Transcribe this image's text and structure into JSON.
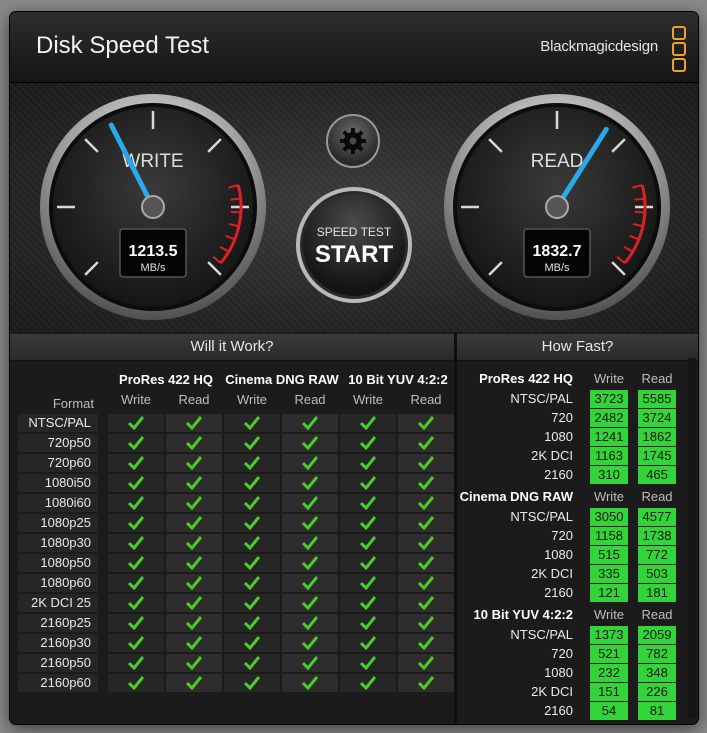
{
  "window": {
    "title": "Disk Speed Test",
    "brand": "Blackmagicdesign"
  },
  "gauges": {
    "write": {
      "label": "WRITE",
      "value": "1213.5",
      "unit": "MB/s",
      "fraction": 0.4
    },
    "read": {
      "label": "READ",
      "value": "1832.7",
      "unit": "MB/s",
      "fraction": 0.62
    }
  },
  "controls": {
    "start_small": "SPEED TEST",
    "start_big": "START",
    "settings_icon": "gear-icon"
  },
  "will_it_work": {
    "title": "Will it Work?",
    "format_header": "Format",
    "groups": [
      {
        "name": "ProRes 422 HQ",
        "cols": [
          "Write",
          "Read"
        ]
      },
      {
        "name": "Cinema DNG RAW",
        "cols": [
          "Write",
          "Read"
        ]
      },
      {
        "name": "10 Bit YUV 4:2:2",
        "cols": [
          "Write",
          "Read"
        ]
      }
    ],
    "formats": [
      "NTSC/PAL",
      "720p50",
      "720p60",
      "1080i50",
      "1080i60",
      "1080p25",
      "1080p30",
      "1080p50",
      "1080p60",
      "2K DCI 25",
      "2160p25",
      "2160p30",
      "2160p50",
      "2160p60"
    ],
    "check_icon": "checkmark-icon"
  },
  "how_fast": {
    "title": "How Fast?",
    "groups": [
      {
        "name": "ProRes 422 HQ",
        "write_label": "Write",
        "read_label": "Read",
        "rows": [
          {
            "label": "NTSC/PAL",
            "write": "3723",
            "read": "5585"
          },
          {
            "label": "720",
            "write": "2482",
            "read": "3724"
          },
          {
            "label": "1080",
            "write": "1241",
            "read": "1862"
          },
          {
            "label": "2K DCI",
            "write": "1163",
            "read": "1745"
          },
          {
            "label": "2160",
            "write": "310",
            "read": "465"
          }
        ]
      },
      {
        "name": "Cinema DNG RAW",
        "write_label": "Write",
        "read_label": "Read",
        "rows": [
          {
            "label": "NTSC/PAL",
            "write": "3050",
            "read": "4577"
          },
          {
            "label": "720",
            "write": "1158",
            "read": "1738"
          },
          {
            "label": "1080",
            "write": "515",
            "read": "772"
          },
          {
            "label": "2K DCI",
            "write": "335",
            "read": "503"
          },
          {
            "label": "2160",
            "write": "121",
            "read": "181"
          }
        ]
      },
      {
        "name": "10 Bit YUV 4:2:2",
        "write_label": "Write",
        "read_label": "Read",
        "rows": [
          {
            "label": "NTSC/PAL",
            "write": "1373",
            "read": "2059"
          },
          {
            "label": "720",
            "write": "521",
            "read": "782"
          },
          {
            "label": "1080",
            "write": "232",
            "read": "348"
          },
          {
            "label": "2K DCI",
            "write": "151",
            "read": "226"
          },
          {
            "label": "2160",
            "write": "54",
            "read": "81"
          }
        ]
      }
    ]
  },
  "colors": {
    "accent_blue": "#2aa8e8",
    "value_green": "#33d43a",
    "check_green": "#4ccc2a",
    "redline": "#e02020",
    "brand_orange": "#f0a030"
  }
}
